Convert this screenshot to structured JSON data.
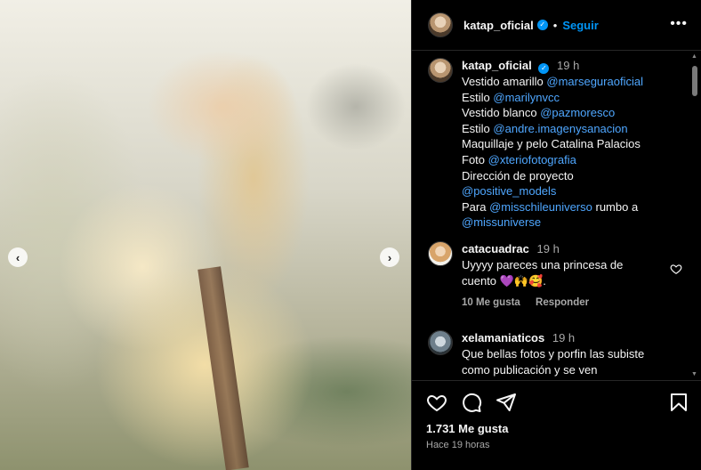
{
  "post": {
    "username": "katap_oficial",
    "follow_label": "Seguir",
    "dot": "•",
    "more_icon": "more-horizontal-icon",
    "likes": "1.731 Me gusta",
    "posted_ago": "Hace 19 horas"
  },
  "photo": {
    "prev_icon": "chevron-left-icon",
    "next_icon": "chevron-right-icon"
  },
  "caption": {
    "username": "katap_oficial",
    "time": "19 h",
    "lines": [
      {
        "text": "Vestido amarillo ",
        "mention": "@marseguraoficial"
      },
      {
        "text": "Estilo ",
        "mention": "@marilynvcc"
      },
      {
        "text": "Vestido blanco ",
        "mention": "@pazmoresco"
      },
      {
        "text": "Estilo ",
        "mention": "@andre.imagenysanacion"
      },
      {
        "text": "Maquillaje y pelo Catalina Palacios",
        "mention": ""
      },
      {
        "text": "Foto ",
        "mention": "@xteriofotografia"
      },
      {
        "text": "Dirección de proyecto",
        "mention": ""
      },
      {
        "text": "",
        "mention": "@positive_models"
      },
      {
        "text": "Para ",
        "mention": "@misschileuniverso",
        "after": " rumbo a"
      },
      {
        "text": "",
        "mention": "@missuniverse"
      }
    ]
  },
  "comments": [
    {
      "username": "catacuadrac",
      "time": "19 h",
      "text_line1": "Uyyyy pareces una princesa de",
      "text_line2": "cuento 💜🙌🥰.",
      "likes": "10 Me gusta",
      "reply": "Responder"
    },
    {
      "username": "xelamaniaticos",
      "time": "19 h",
      "text_line1": "Que bellas fotos y porfin las subiste",
      "text_line2": "como publicación y se ven"
    }
  ],
  "colors": {
    "background": "#000000",
    "accent": "#0095f6",
    "mention": "#4fa7ff",
    "muted": "#a8a8a8"
  }
}
